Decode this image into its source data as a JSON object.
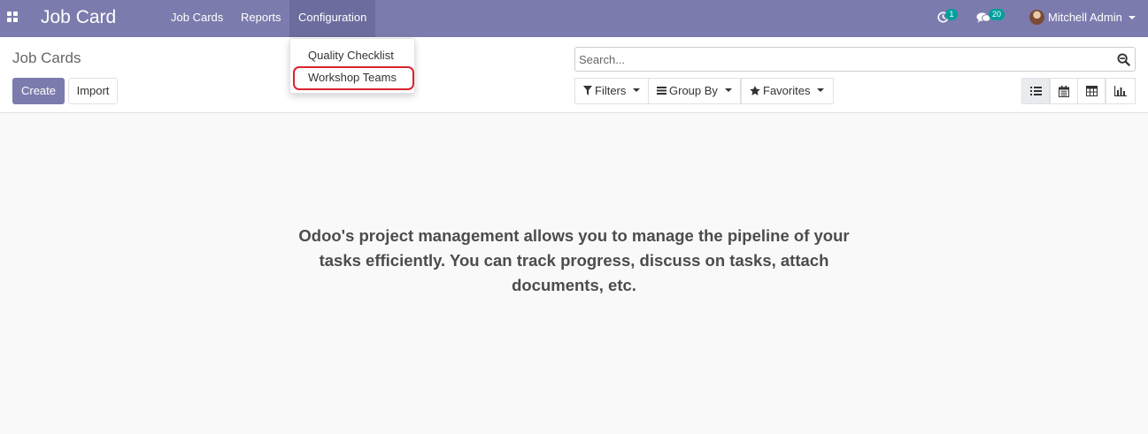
{
  "navbar": {
    "brand": "Job Card",
    "menus": [
      "Job Cards",
      "Reports",
      "Configuration"
    ],
    "activity_count": "1",
    "message_count": "20",
    "user_name": "Mitchell Admin",
    "bg_color": "#7c7bad"
  },
  "control_panel": {
    "breadcrumb": "Job Cards",
    "create_label": "Create",
    "import_label": "Import",
    "search_placeholder": "Search...",
    "filters_label": "Filters",
    "group_by_label": "Group By",
    "favorites_label": "Favorites",
    "views": [
      "list-icon",
      "calendar-icon",
      "pivot-icon",
      "graph-icon"
    ],
    "active_view": "list-icon"
  },
  "dropdown": {
    "items": [
      "Quality Checklist",
      "Workshop Teams"
    ],
    "highlighted": "Workshop Teams",
    "highlight_color": "#d9232d"
  },
  "main": {
    "helper_text": "Odoo's project management allows you to manage the pipeline of your tasks efficiently. You can track progress, discuss on tasks, attach documents, etc."
  }
}
